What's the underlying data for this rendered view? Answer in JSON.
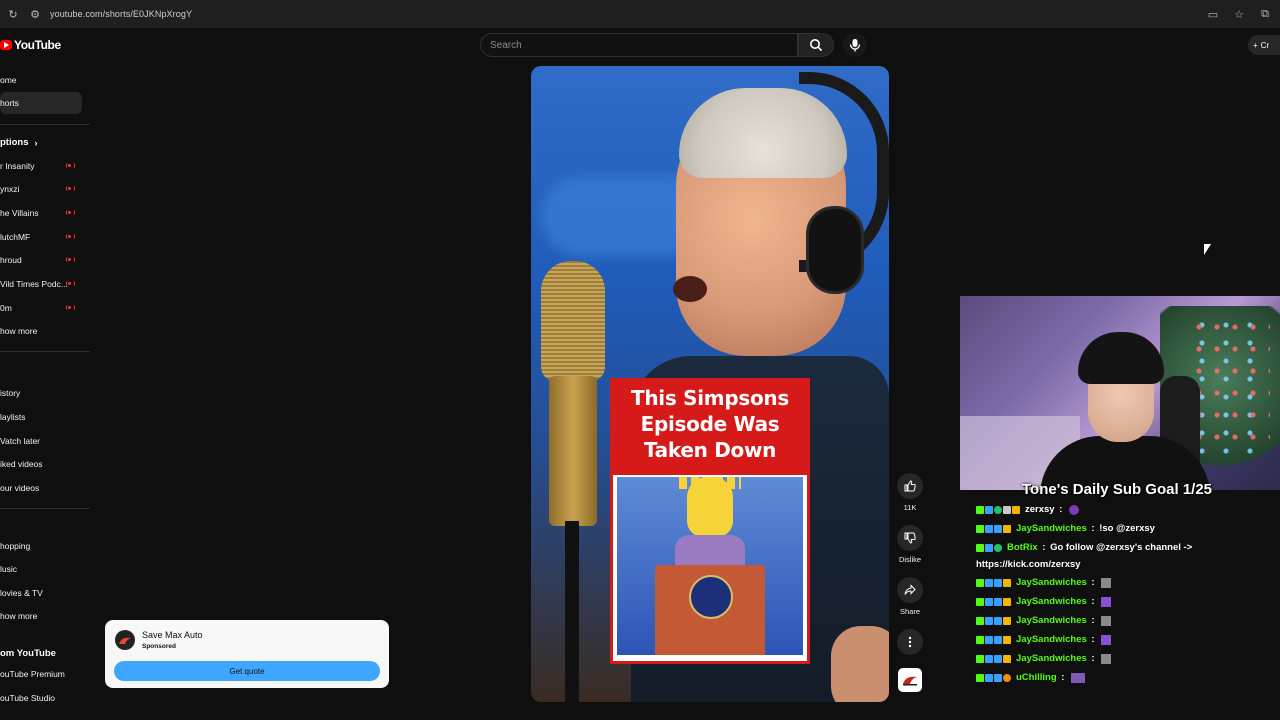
{
  "browser": {
    "url": "youtube.com/shorts/E0JKNpXrogY"
  },
  "header": {
    "logo_text": "YouTube",
    "search_placeholder": "Search",
    "create_label": "Cr"
  },
  "sidebar": {
    "main": [
      {
        "label": "ome",
        "active": false
      },
      {
        "label": "horts",
        "active": true
      }
    ],
    "subscriptions_heading": "ptions",
    "subscriptions": [
      {
        "label": "r Insanity"
      },
      {
        "label": "ynxzi"
      },
      {
        "label": "he Villains"
      },
      {
        "label": "lutchMF"
      },
      {
        "label": "hroud"
      },
      {
        "label": "Vild Times Podc..."
      },
      {
        "label": "0m"
      }
    ],
    "subs_show_more": "how more",
    "you": [
      {
        "label": "istory"
      },
      {
        "label": "laylists"
      },
      {
        "label": "Vatch later"
      },
      {
        "label": "iked videos"
      },
      {
        "label": "our videos"
      }
    ],
    "explore": [
      {
        "label": "hopping"
      },
      {
        "label": "lusic"
      },
      {
        "label": "lovies & TV"
      }
    ],
    "explore_show_more": "how more",
    "more_heading": "om YouTube",
    "more": [
      {
        "label": "ouTube Premium"
      },
      {
        "label": "ouTube Studio"
      }
    ]
  },
  "short": {
    "overlay_title_line1": "This Simpsons",
    "overlay_title_line2": "Episode Was",
    "overlay_title_line3": "Taken Down"
  },
  "actions": {
    "like_count": "11K",
    "dislike_label": "Dislike",
    "share_label": "Share"
  },
  "ad": {
    "name": "Save Max Auto",
    "sponsored": "Sponsored",
    "cta": "Get quote"
  },
  "stream": {
    "sub_goal": "Tone's Daily Sub Goal 1/25",
    "chat": [
      {
        "user": "zerxsy",
        "color": "#53fc18",
        "text": ""
      },
      {
        "user": "JaySandwiches",
        "color": "#53fc18",
        "text": "!so @zerxsy"
      },
      {
        "user": "BotRix",
        "color": "#53fc18",
        "text": "Go follow @zerxsy's channel ->"
      },
      {
        "user": "",
        "color": "#ffffff",
        "text": "https://kick.com/zerxsy"
      },
      {
        "user": "JaySandwiches",
        "color": "#53fc18",
        "text": ""
      },
      {
        "user": "JaySandwiches",
        "color": "#53fc18",
        "text": ""
      },
      {
        "user": "JaySandwiches",
        "color": "#53fc18",
        "text": ""
      },
      {
        "user": "JaySandwiches",
        "color": "#53fc18",
        "text": ""
      },
      {
        "user": "JaySandwiches",
        "color": "#53fc18",
        "text": ""
      },
      {
        "user": "uChilling",
        "color": "#53fc18",
        "text": ""
      }
    ]
  },
  "colors": {
    "background": "#0f0f0f",
    "accent_red": "#ff0000",
    "cta_blue": "#3ea6ff",
    "kick_green": "#53fc18"
  }
}
